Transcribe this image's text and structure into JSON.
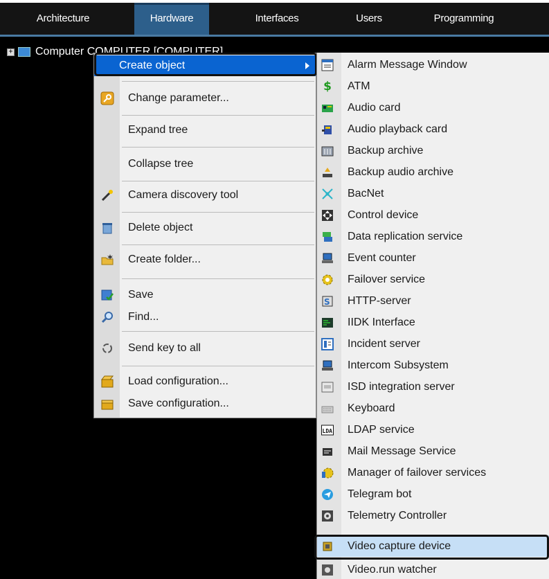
{
  "tabs": [
    {
      "label": "Architecture",
      "active": false
    },
    {
      "label": "Hardware",
      "active": true
    },
    {
      "label": "Interfaces",
      "active": false
    },
    {
      "label": "Users",
      "active": false
    },
    {
      "label": "Programming",
      "active": false
    }
  ],
  "tree": {
    "expander": "+",
    "node_label": "Computer COMPUTER [COMPUTER]"
  },
  "context_menu": {
    "items": [
      {
        "label": "Create object",
        "icon": "none",
        "submenu": true
      },
      {
        "label": "Change parameter...",
        "icon": "wrench-icon"
      },
      {
        "label": "Expand tree",
        "icon": "none"
      },
      {
        "label": "Collapse tree",
        "icon": "none"
      },
      {
        "label": "Camera discovery tool",
        "icon": "magic-wand-icon"
      },
      {
        "label": "Delete object",
        "icon": "trash-icon"
      },
      {
        "label": "Create folder...",
        "icon": "folder-icon"
      },
      {
        "label": "Save",
        "icon": "save-icon"
      },
      {
        "label": "Find...",
        "icon": "magnifier-icon"
      },
      {
        "label": "Send key to all",
        "icon": "sync-icon"
      },
      {
        "label": "Load configuration...",
        "icon": "box-open-icon"
      },
      {
        "label": "Save configuration...",
        "icon": "box-icon"
      }
    ]
  },
  "submenu": {
    "items": [
      {
        "label": "Alarm Message Window",
        "icon": "message-window-icon"
      },
      {
        "label": "ATM",
        "icon": "dollar-icon"
      },
      {
        "label": "Audio card",
        "icon": "audio-card-icon"
      },
      {
        "label": "Audio playback card",
        "icon": "playback-card-icon"
      },
      {
        "label": "Backup archive",
        "icon": "archive-icon"
      },
      {
        "label": "Backup audio archive",
        "icon": "audio-archive-icon"
      },
      {
        "label": "BacNet",
        "icon": "network-icon"
      },
      {
        "label": "Control device",
        "icon": "move-icon"
      },
      {
        "label": "Data replication service",
        "icon": "replication-icon"
      },
      {
        "label": "Event counter",
        "icon": "counter-icon"
      },
      {
        "label": "Failover service",
        "icon": "failover-icon"
      },
      {
        "label": "HTTP-server",
        "icon": "server-icon"
      },
      {
        "label": "IIDK Interface",
        "icon": "terminal-icon"
      },
      {
        "label": "Incident server",
        "icon": "incident-icon"
      },
      {
        "label": "Intercom Subsystem",
        "icon": "intercom-icon"
      },
      {
        "label": "ISD integration server",
        "icon": "integration-icon"
      },
      {
        "label": "Keyboard",
        "icon": "keyboard-icon"
      },
      {
        "label": "LDAP service",
        "icon": "ldap-icon"
      },
      {
        "label": "Mail Message Service",
        "icon": "mail-icon"
      },
      {
        "label": "Manager of failover services",
        "icon": "manager-icon"
      },
      {
        "label": "Telegram bot",
        "icon": "telegram-icon"
      },
      {
        "label": "Telemetry Controller",
        "icon": "telemetry-icon"
      },
      {
        "label": "Video capture device",
        "icon": "chip-icon",
        "selected": true
      },
      {
        "label": "Video.run watcher",
        "icon": "watcher-icon"
      }
    ]
  }
}
